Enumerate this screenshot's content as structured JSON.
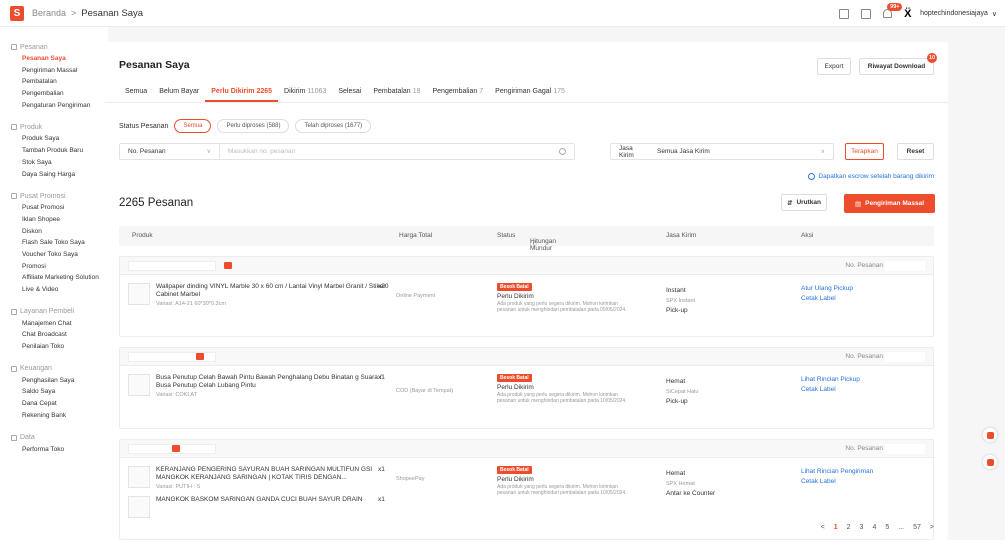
{
  "topbar": {
    "logo": "S",
    "breadcrumb_home": "Beranda",
    "breadcrumb_sep": ">",
    "breadcrumb_current": "Pesanan Saya",
    "notif_badge": "99+",
    "username": "hoptechindonesiajaya",
    "username_chevron": "∨",
    "icons": [
      "grid-icon",
      "book-icon",
      "bell-icon"
    ]
  },
  "sidebar": {
    "groups": [
      {
        "title": "Pesanan",
        "items": [
          "Pesanan Saya",
          "Pengiriman Massal",
          "Pembatalan",
          "Pengembalian",
          "Pengaturan Pengiriman"
        ]
      },
      {
        "title": "Produk",
        "items": [
          "Produk Saya",
          "Tambah Produk Baru",
          "Stok Saya",
          "Daya Saing Harga"
        ]
      },
      {
        "title": "Pusat Promosi",
        "items": [
          "Pusat Promosi",
          "Iklan Shopee",
          "Diskon",
          "Flash Sale Toko Saya",
          "Voucher Toko Saya",
          "Promosi",
          "Affiliate Marketing Solution",
          "Live & Video"
        ]
      },
      {
        "title": "Layanan Pembeli",
        "items": [
          "Manajemen Chat",
          "Chat Broadcast",
          "Penilaian Toko"
        ]
      },
      {
        "title": "Keuangan",
        "items": [
          "Penghasilan Saya",
          "Saldo Saya",
          "Dana Cepat",
          "Rekening Bank"
        ]
      },
      {
        "title": "Data",
        "items": [
          "Performa Toko"
        ]
      }
    ],
    "active_item": "Pesanan Saya"
  },
  "main": {
    "title": "Pesanan Saya",
    "export_label": "Export",
    "riwayat_label": "Riwayat Download",
    "riwayat_badge": "10",
    "tabs": [
      {
        "label": "Semua",
        "count": ""
      },
      {
        "label": "Belum Bayar",
        "count": ""
      },
      {
        "label": "Perlu Dikirim",
        "count": "2265"
      },
      {
        "label": "Dikirim",
        "count": "11063"
      },
      {
        "label": "Selesai",
        "count": ""
      },
      {
        "label": "Pembatalan",
        "count": "18"
      },
      {
        "label": "Pengembalian",
        "count": "7"
      },
      {
        "label": "Pengiriman Gagal",
        "count": "175"
      }
    ],
    "active_tab": "Perlu Dikirim",
    "status_label": "Status Pesanan",
    "status_pills": [
      "Semua",
      "Perlu diproses (588)",
      "Telah diproses (1677)"
    ],
    "filter_field": "No. Pesanan",
    "filter_placeholder": "Masukkan no. pesanan",
    "jasa_label": "Jasa Kirim",
    "jasa_value": "Semua Jasa Kirim",
    "terapkan_label": "Terapkan",
    "reset_label": "Reset",
    "escrow_text": "Dapatkan escrow setelah barang dikirim",
    "count_title": "2265 Pesanan",
    "urutkan_label": "Urutkan",
    "massal_label": "Pengiriman Massal",
    "table_headers": [
      "Produk",
      "Harga Total",
      "Status",
      "Hitungan Mundur",
      "Jasa Kirim",
      "Aksi"
    ],
    "order_no_label": "No. Pesanan",
    "pagination": {
      "prev": "<",
      "pages": [
        "1",
        "2",
        "3",
        "4",
        "5",
        "...",
        "57"
      ],
      "next": ">",
      "current": "1"
    }
  },
  "orders": [
    {
      "products": [
        {
          "name": "Wallpaper dinding VINYL Marble 30 x 60 cm / Lantai Vinyl Marbel Granit / Stiker Cabinet Marbel",
          "variant": "Variasi: A14-21 60*30*0.3cm",
          "qty": "x20"
        }
      ],
      "payment": "Online Payment",
      "chip": "Besok Batal",
      "status": "Perlu Dikirim",
      "note": "Ada produk yang perlu segera dikirim. Mohon kirimkan pesanan untuk menghindari pembatalan pada 09/05/2024.",
      "ship": [
        "Instant",
        "SPX Instant",
        "Pick-up"
      ],
      "actions": [
        "Atur Ulang Pickup",
        "Cetak Label"
      ]
    },
    {
      "products": [
        {
          "name": "Busa Penutup Celah Bawah Pintu Bawah Penghalang Debu Binatan g Suara / Busa Penutup Celah Lubang Pintu",
          "variant": "Variasi: COKLAT",
          "qty": "x1"
        }
      ],
      "payment": "COD (Bayar di Tempat)",
      "chip": "Besok Batal",
      "status": "Perlu Dikirim",
      "note": "Ada produk yang perlu segera dikirim. Mohon kirimkan pesanan untuk menghindari pembatalan pada 10/05/2024.",
      "ship": [
        "Hemat",
        "SiCepat Halu",
        "Pick-up"
      ],
      "actions": [
        "Lihat Rincian Pickup",
        "Cetak Label"
      ]
    },
    {
      "products": [
        {
          "name": "KERANJANG PENGERING SAYURAN BUAH SARINGAN MULTIFUN GSI MANGKOK KERANJANG SARINGAN | KOTAK TIRIS DENGAN...",
          "variant": "Variasi: PUTIH : S",
          "qty": "x1"
        },
        {
          "name": "MANGKOK BASKOM SARINGAN GANDA CUCI BUAH SAYUR DRAIN",
          "variant": "",
          "qty": "x1"
        }
      ],
      "payment": "ShopeePay",
      "chip": "Besok Batal",
      "status": "Perlu Dikirim",
      "note": "Ada produk yang perlu segera dikirim. Mohon kirimkan pesanan untuk menghindari pembatalan pada 10/05/2024.",
      "ship": [
        "Hemat",
        "SPX Hemat",
        "Antar ke Counter"
      ],
      "actions": [
        "Lihat Rincian Pengiriman",
        "Cetak Label"
      ]
    }
  ]
}
